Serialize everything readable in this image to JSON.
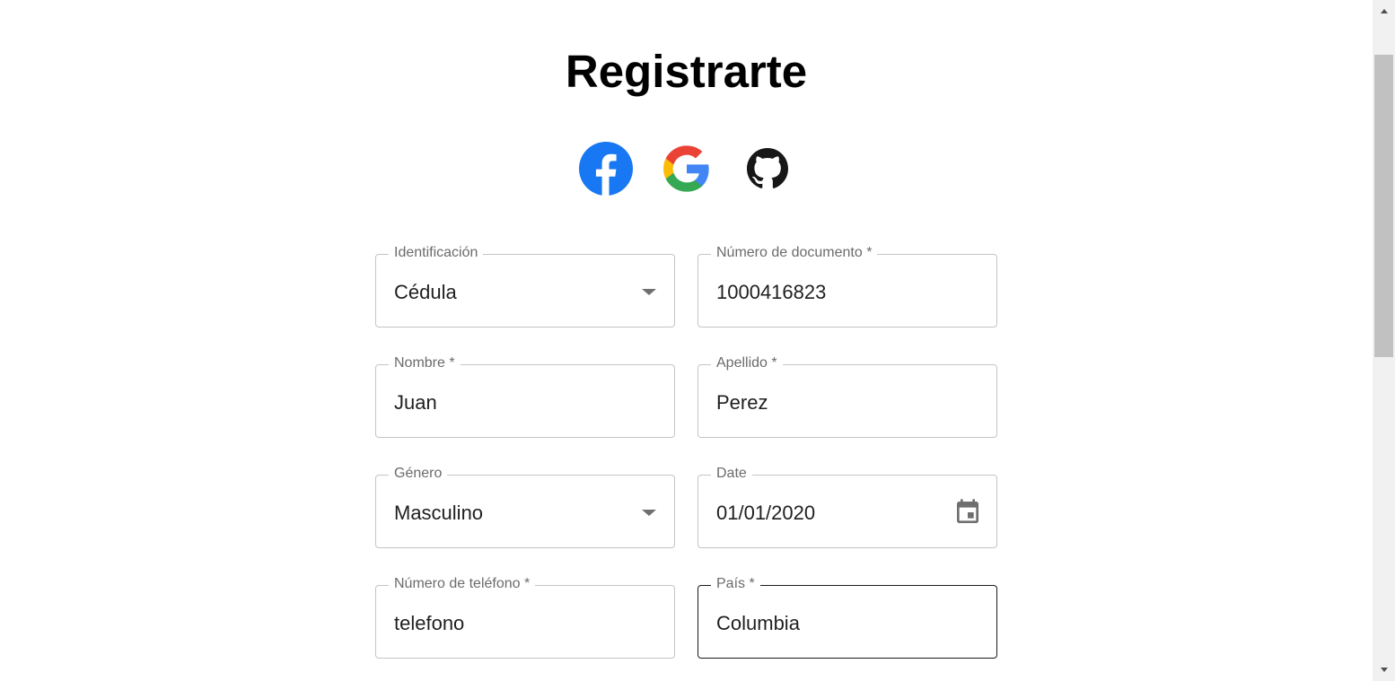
{
  "page": {
    "title": "Registrarte"
  },
  "social": {
    "facebook_icon": "facebook-icon",
    "google_icon": "google-icon",
    "github_icon": "github-icon",
    "colors": {
      "facebook": "#1877f2",
      "google_blue": "#4285f4",
      "google_red": "#ea4335",
      "google_yellow": "#fbbc05",
      "google_green": "#34a853",
      "github": "#181717"
    }
  },
  "form": {
    "identificacion": {
      "label": "Identificación",
      "value": "Cédula"
    },
    "numero_documento": {
      "label": "Número de documento *",
      "value": "1000416823"
    },
    "nombre": {
      "label": "Nombre *",
      "value": "Juan"
    },
    "apellido": {
      "label": "Apellido *",
      "value": "Perez"
    },
    "genero": {
      "label": "Género",
      "value": "Masculino"
    },
    "date": {
      "label": "Date",
      "value": "01/01/2020"
    },
    "telefono": {
      "label": "Número de teléfono *",
      "value": "telefono"
    },
    "pais": {
      "label": "País *",
      "value": "Columbia"
    }
  }
}
